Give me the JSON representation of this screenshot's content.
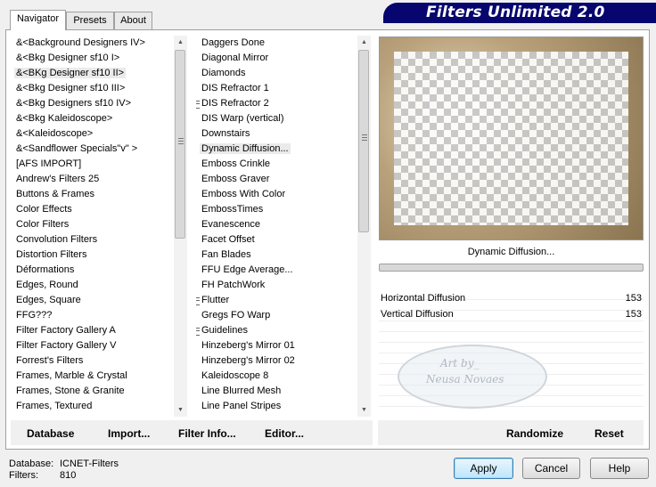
{
  "tabs": [
    {
      "label": "Navigator"
    },
    {
      "label": "Presets"
    },
    {
      "label": "About"
    }
  ],
  "banner": {
    "title": "Filters Unlimited 2.0",
    "color": "#06066e"
  },
  "categories": [
    {
      "label": "&<Background Designers IV>",
      "selected": false
    },
    {
      "label": "&<Bkg Designer sf10 I>",
      "selected": false
    },
    {
      "label": "&<BKg Designer sf10 II>",
      "selected": true
    },
    {
      "label": "&<Bkg Designer sf10 III>",
      "selected": false
    },
    {
      "label": "&<Bkg Designers sf10 IV>",
      "selected": false
    },
    {
      "label": "&<Bkg Kaleidoscope>",
      "selected": false
    },
    {
      "label": "&<Kaleidoscope>",
      "selected": false
    },
    {
      "label": "&<Sandflower Specials\"v\" >",
      "selected": false
    },
    {
      "label": "[AFS IMPORT]",
      "selected": false
    },
    {
      "label": "Andrew's Filters 25",
      "selected": false
    },
    {
      "label": "Buttons & Frames",
      "selected": false
    },
    {
      "label": "Color Effects",
      "selected": false
    },
    {
      "label": "Color Filters",
      "selected": false
    },
    {
      "label": "Convolution Filters",
      "selected": false
    },
    {
      "label": "Distortion Filters",
      "selected": false
    },
    {
      "label": "Déformations",
      "selected": false
    },
    {
      "label": "Edges, Round",
      "selected": false
    },
    {
      "label": "Edges, Square",
      "selected": false
    },
    {
      "label": "FFG???",
      "selected": false
    },
    {
      "label": "Filter Factory Gallery A",
      "selected": false
    },
    {
      "label": "Filter Factory Gallery V",
      "selected": false
    },
    {
      "label": "Forrest's Filters",
      "selected": false
    },
    {
      "label": "Frames, Marble & Crystal",
      "selected": false
    },
    {
      "label": "Frames, Stone & Granite",
      "selected": false
    },
    {
      "label": "Frames, Textured",
      "selected": false
    }
  ],
  "filters": [
    {
      "label": "Daggers Done",
      "grip": false,
      "selected": false
    },
    {
      "label": "Diagonal Mirror",
      "grip": false,
      "selected": false
    },
    {
      "label": "Diamonds",
      "grip": false,
      "selected": false
    },
    {
      "label": "DIS Refractor 1",
      "grip": false,
      "selected": false
    },
    {
      "label": "DIS Refractor 2",
      "grip": true,
      "selected": false
    },
    {
      "label": "DIS Warp (vertical)",
      "grip": false,
      "selected": false
    },
    {
      "label": "Downstairs",
      "grip": false,
      "selected": false
    },
    {
      "label": "Dynamic Diffusion...",
      "grip": false,
      "selected": true
    },
    {
      "label": "Emboss Crinkle",
      "grip": false,
      "selected": false
    },
    {
      "label": "Emboss Graver",
      "grip": false,
      "selected": false
    },
    {
      "label": "Emboss With Color",
      "grip": false,
      "selected": false
    },
    {
      "label": "EmbossTimes",
      "grip": false,
      "selected": false
    },
    {
      "label": "Evanescence",
      "grip": false,
      "selected": false
    },
    {
      "label": "Facet Offset",
      "grip": false,
      "selected": false
    },
    {
      "label": "Fan Blades",
      "grip": false,
      "selected": false
    },
    {
      "label": "FFU Edge Average...",
      "grip": false,
      "selected": false
    },
    {
      "label": "FH PatchWork",
      "grip": false,
      "selected": false
    },
    {
      "label": "Flutter",
      "grip": true,
      "selected": false
    },
    {
      "label": "Gregs FO Warp",
      "grip": false,
      "selected": false
    },
    {
      "label": "Guidelines",
      "grip": true,
      "selected": false
    },
    {
      "label": "Hinzeberg's Mirror 01",
      "grip": false,
      "selected": false
    },
    {
      "label": "Hinzeberg's Mirror 02",
      "grip": false,
      "selected": false
    },
    {
      "label": "Kaleidoscope 8",
      "grip": false,
      "selected": false
    },
    {
      "label": "Line Blurred Mesh",
      "grip": false,
      "selected": false
    },
    {
      "label": "Line Panel Stripes",
      "grip": false,
      "selected": false
    }
  ],
  "preview": {
    "caption": "Dynamic Diffusion..."
  },
  "params": [
    {
      "name": "Horizontal Diffusion",
      "value": "153"
    },
    {
      "name": "Vertical Diffusion",
      "value": "153"
    }
  ],
  "watermark": {
    "line1": "Art by_",
    "line2": "Neusa Novaes"
  },
  "bottom": {
    "database": "Database",
    "import": "Import...",
    "filter_info": "Filter Info...",
    "editor": "Editor...",
    "randomize": "Randomize",
    "reset": "Reset"
  },
  "status": {
    "db_label": "Database:",
    "db_value": "ICNET-Filters",
    "filters_label": "Filters:",
    "filters_value": "810"
  },
  "buttons": {
    "apply": "Apply",
    "cancel": "Cancel",
    "help": "Help"
  }
}
